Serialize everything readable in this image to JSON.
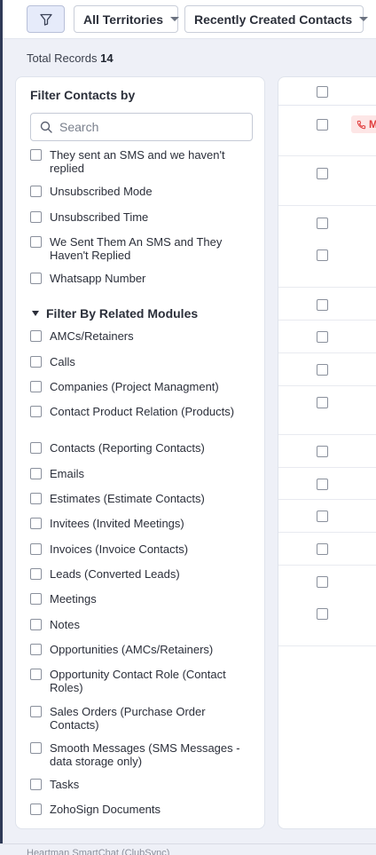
{
  "toolbar": {
    "territory_label": "All Territories",
    "view_label": "Recently Created Contacts"
  },
  "summary": {
    "total_label": "Total Records",
    "total_count": "14"
  },
  "filter_panel": {
    "title": "Filter Contacts by",
    "search_placeholder": "Search",
    "field_options": [
      "They sent an SMS and we haven't replied",
      "Unsubscribed Mode",
      "Unsubscribed Time",
      "We Sent Them An SMS and They Haven't Replied",
      "Whatsapp Number"
    ],
    "related_section_title": "Filter By Related Modules",
    "related_options": [
      "AMCs/Retainers",
      "Calls",
      "Companies (Project Managment)",
      "Contact Product Relation (Products)",
      "Contacts (Reporting Contacts)",
      "Emails",
      "Estimates (Estimate Contacts)",
      "Invitees (Invited Meetings)",
      "Invoices (Invoice Contacts)",
      "Leads (Converted Leads)",
      "Meetings",
      "Notes",
      "Opportunities (AMCs/Retainers)",
      "Opportunity Contact Role (Contact Roles)",
      "Sales Orders (Purchase Order Contacts)",
      "Smooth Messages (SMS Messages - data storage only)",
      "Tasks",
      "ZohoSign Documents"
    ]
  },
  "table": {
    "first_row_badge": "M"
  },
  "footer": {
    "hint": "Heartman SmartChat (ClubSync)"
  },
  "colors": {
    "accent": "#e6ebfa",
    "missed_call_bg": "#fde6e6",
    "missed_call_text": "#e03b3b"
  }
}
